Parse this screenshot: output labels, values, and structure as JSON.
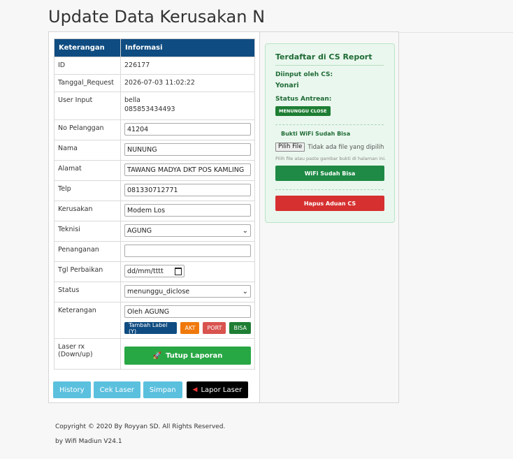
{
  "page": {
    "title": "Update Data Kerusakan N"
  },
  "table": {
    "header_label": "Keterangan",
    "header_value": "Informasi",
    "id_label": "ID",
    "id_value": "226177",
    "tanggal_label": "Tanggal_Request",
    "tanggal_value": "2026-07-03 11:02:22",
    "user_label": "User Input",
    "user_name": "bella",
    "user_phone": "085853434493",
    "no_pelanggan_label": "No Pelanggan",
    "no_pelanggan_value": "41204",
    "nama_label": "Nama",
    "nama_value": "NUNUNG",
    "alamat_label": "Alamat",
    "alamat_value": "TAWANG MADYA DKT POS KAMLING",
    "telp_label": "Telp",
    "telp_value": "081330712771",
    "kerusakan_label": "Kerusakan",
    "kerusakan_value": "Modem Los",
    "teknisi_label": "Teknisi",
    "teknisi_value": "AGUNG",
    "penanganan_label": "Penanganan",
    "penanganan_value": "",
    "tgl_label": "Tgl Perbaikan",
    "tgl_value": "dd/mm/tttt",
    "status_label": "Status",
    "status_value": "menunggu_diclose",
    "keterangan_label": "Keterangan",
    "keterangan_value": "Oleh  AGUNG",
    "tag_labels": [
      "Tambah Label (Y)",
      "AKT",
      "PORT",
      "BISA"
    ],
    "laser_label": "Laser rx (Down/up)",
    "tutup_label": "Tutup Laporan"
  },
  "bottom_buttons": {
    "history": "History",
    "cek_laser": "Cek Laser",
    "simpan": "Simpan",
    "lapor_laser": "Lapor Laser"
  },
  "cs_report": {
    "title": "Terdaftar di CS Report",
    "diinput_label": "Diinput oleh CS:",
    "diinput_value": "Yonari",
    "status_label": "Status Antrean:",
    "status_badge": "MENUNGGU CLOSE",
    "bukti_title": "Bukti WiFi Sudah Bisa",
    "file_button": "Pilih File",
    "file_status": "Tidak ada file yang dipilih",
    "hint": "Pilih file atau paste gambar bukti di halaman ini.",
    "wifi_button": "WiFi Sudah Bisa",
    "hapus_button": "Hapus Aduan CS"
  },
  "footer": {
    "copyright": "Copyright © 2020 By Royyan SD. All Rights Reserved.",
    "version": "by Wifi Madiun V24.1"
  },
  "colors": {
    "header_blue": "#0f4c81",
    "success_green": "#28a745",
    "danger_red": "#d9534f",
    "info_blue": "#5bc0de"
  }
}
